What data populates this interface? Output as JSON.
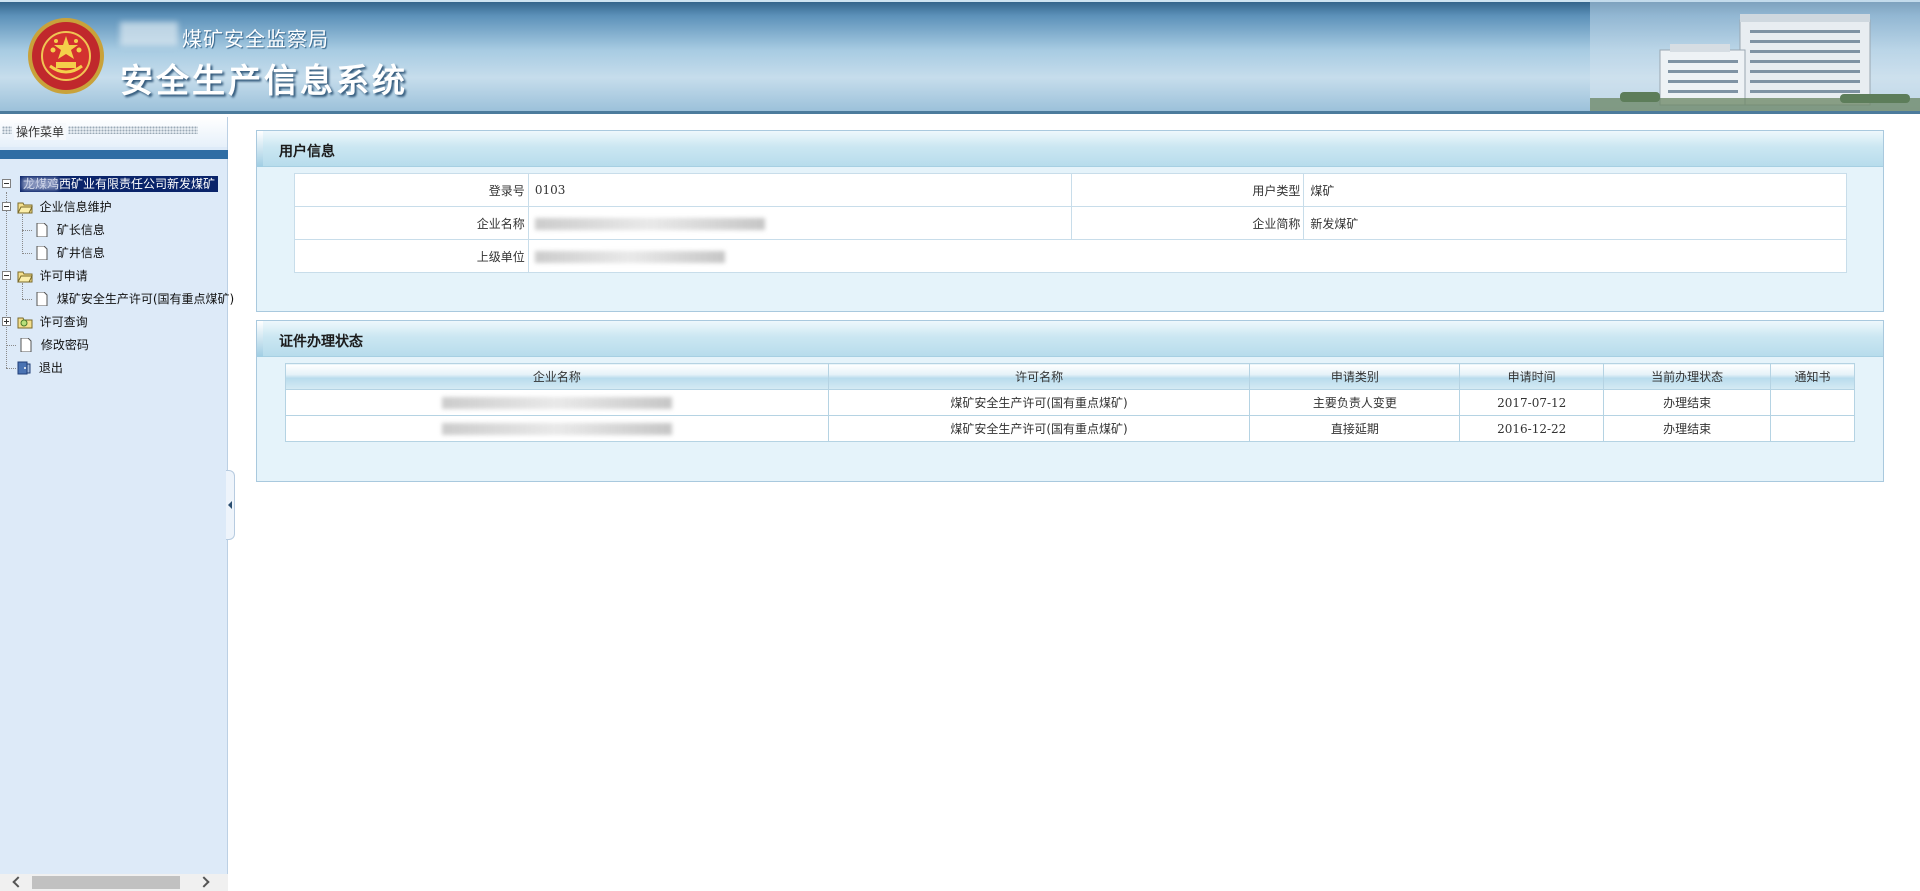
{
  "header": {
    "subtitle": "煤矿安全监察局",
    "title": "安全生产信息系统"
  },
  "sidebar": {
    "menu_title": "操作菜单",
    "root_label": "龙煤鸡西矿业有限责任公司新发煤矿",
    "items": [
      {
        "label": "企业信息维护",
        "type": "folder",
        "expanded": true
      },
      {
        "label": "矿长信息",
        "type": "page"
      },
      {
        "label": "矿井信息",
        "type": "page"
      },
      {
        "label": "许可申请",
        "type": "folder",
        "expanded": true
      },
      {
        "label": "煤矿安全生产许可(国有重点煤矿)",
        "type": "page"
      },
      {
        "label": "许可查询",
        "type": "folder",
        "expanded": false
      },
      {
        "label": "修改密码",
        "type": "page"
      },
      {
        "label": "退出",
        "type": "exit"
      }
    ]
  },
  "user_info": {
    "title": "用户信息",
    "login_label": "登录号",
    "login_value": "0103",
    "user_type_label": "用户类型",
    "user_type_value": "煤矿",
    "company_label": "企业名称",
    "company_short_label": "企业简称",
    "company_short_value": "新发煤矿",
    "parent_label": "上级单位"
  },
  "cert_status": {
    "title": "证件办理状态",
    "columns": [
      "企业名称",
      "许可名称",
      "申请类别",
      "申请时间",
      "当前办理状态",
      "通知书"
    ],
    "rows": [
      {
        "license": "煤矿安全生产许可(国有重点煤矿)",
        "category": "主要负责人变更",
        "date": "2017-07-12",
        "status": "办理结束",
        "notice": ""
      },
      {
        "license": "煤矿安全生产许可(国有重点煤矿)",
        "category": "直接延期",
        "date": "2016-12-22",
        "status": "办理结束",
        "notice": ""
      }
    ]
  },
  "colors": {
    "header_blue": "#5c91b9",
    "sidebar_bg": "#ddeaf8",
    "selected_node": "#0a246a",
    "panel_bg": "#e5f3fa"
  }
}
